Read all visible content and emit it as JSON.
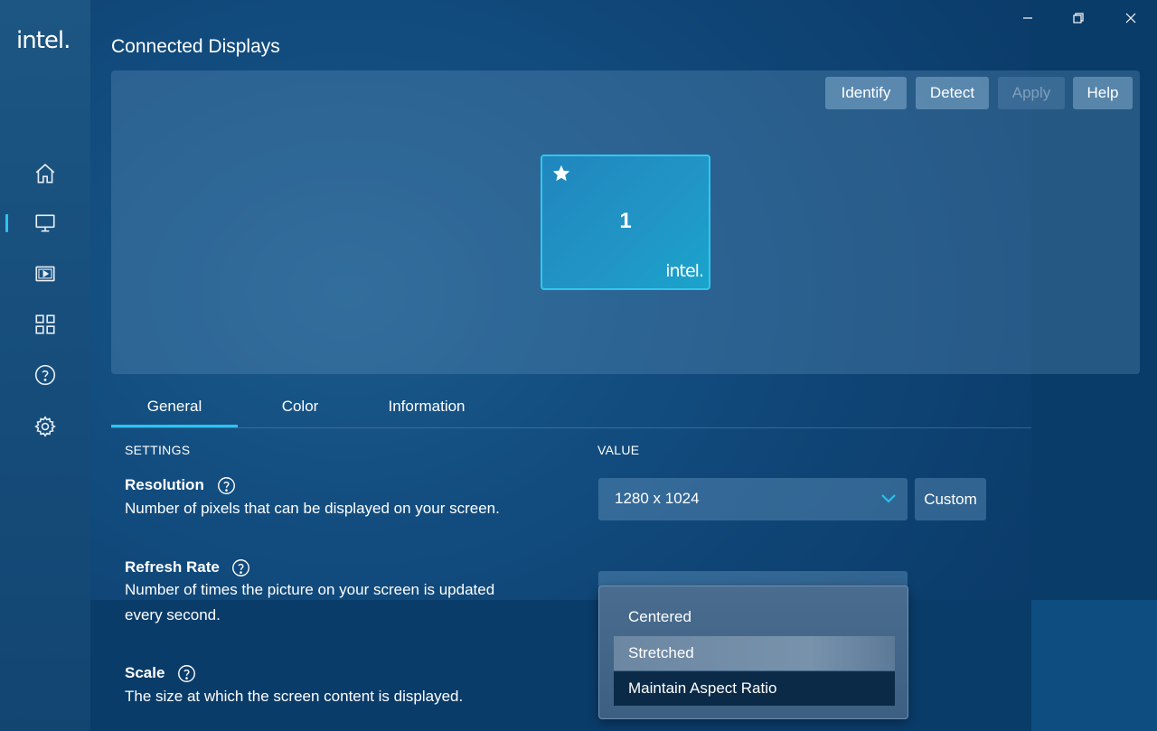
{
  "app": {
    "logo_text": "intel."
  },
  "window": {
    "minimize_icon": "minimize-icon",
    "restore_icon": "restore-icon",
    "close_icon": "close-icon"
  },
  "sidebar": {
    "items": [
      {
        "name": "home",
        "icon": "home-icon"
      },
      {
        "name": "display",
        "icon": "monitor-icon",
        "active": true
      },
      {
        "name": "video",
        "icon": "video-icon"
      },
      {
        "name": "apps",
        "icon": "grid-icon"
      },
      {
        "name": "help",
        "icon": "question-icon"
      },
      {
        "name": "settings",
        "icon": "gear-icon"
      }
    ],
    "accent_color": "#2ec3f2"
  },
  "page": {
    "title": "Connected Displays"
  },
  "toolbar": {
    "identify_label": "Identify",
    "detect_label": "Detect",
    "apply_label": "Apply",
    "help_label": "Help"
  },
  "display": {
    "number": "1",
    "primary_icon": "star-icon",
    "brand_text": "intel."
  },
  "tabs": [
    {
      "label": "General",
      "active": true
    },
    {
      "label": "Color"
    },
    {
      "label": "Information"
    }
  ],
  "settings": {
    "col_settings": "SETTINGS",
    "col_value": "VALUE",
    "resolution": {
      "label": "Resolution",
      "description": "Number of pixels that can be displayed on your screen.",
      "value": "1280 x 1024",
      "custom_label": "Custom"
    },
    "refresh_rate": {
      "label": "Refresh Rate",
      "description_line1": "Number of times the picture on your screen is updated",
      "description_line2": "every second."
    },
    "scale": {
      "label": "Scale",
      "description": "The size at which the screen content is displayed."
    }
  },
  "dropdown": {
    "options": [
      "Centered",
      "Stretched",
      "Maintain Aspect Ratio"
    ],
    "hovered": "Stretched",
    "selected": "Maintain Aspect Ratio"
  }
}
